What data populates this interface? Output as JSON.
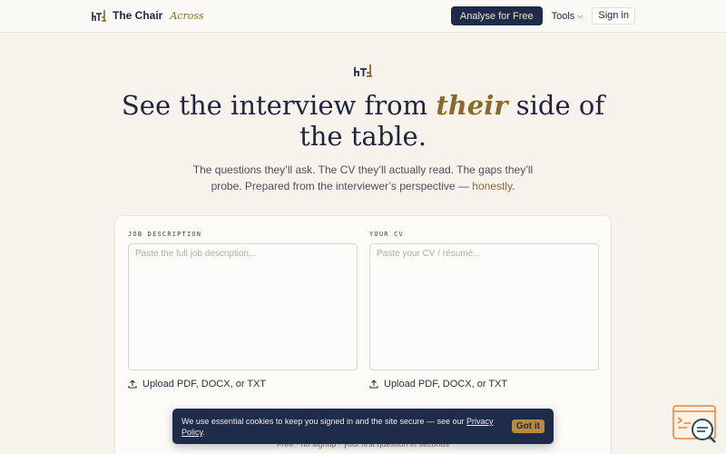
{
  "header": {
    "brand_name": "The Chair",
    "brand_sub": "Across",
    "analyse_label": "Analyse for Free",
    "tools_label": "Tools",
    "signin_label": "Sign in"
  },
  "hero": {
    "title_before": "See the interview from ",
    "title_emphasis": "their",
    "title_after": " side of the table.",
    "subtitle_main": "The questions they’ll ask. The CV they’ll actually read. The gaps they’ll probe. Prepared from the interviewer’s perspective — ",
    "subtitle_accent": "honestly",
    "subtitle_end": "."
  },
  "form": {
    "job_label": "Job Description",
    "job_placeholder": "Paste the full job description...",
    "cv_label": "Your CV",
    "cv_placeholder": "Paste your CV / résumé...",
    "upload_label": "Upload PDF, DOCX, or TXT",
    "footnote": "Free · no signup · your first question in seconds"
  },
  "cookie": {
    "text": "We use essential cookies to keep you signed in and the site secure — see our ",
    "link": "Privacy Policy",
    "end": ".",
    "button": "Got it"
  },
  "colors": {
    "background": "#f7f3ec",
    "navy": "#1f2b4a",
    "gold": "#8a6a2a",
    "button_gold": "#b88a3a",
    "widget_orange": "#e8823a"
  },
  "icons": {
    "brand": "chair-table-logo",
    "upload": "upload-icon",
    "tools": "chevron-down-icon",
    "help": "chat-help-icon"
  }
}
